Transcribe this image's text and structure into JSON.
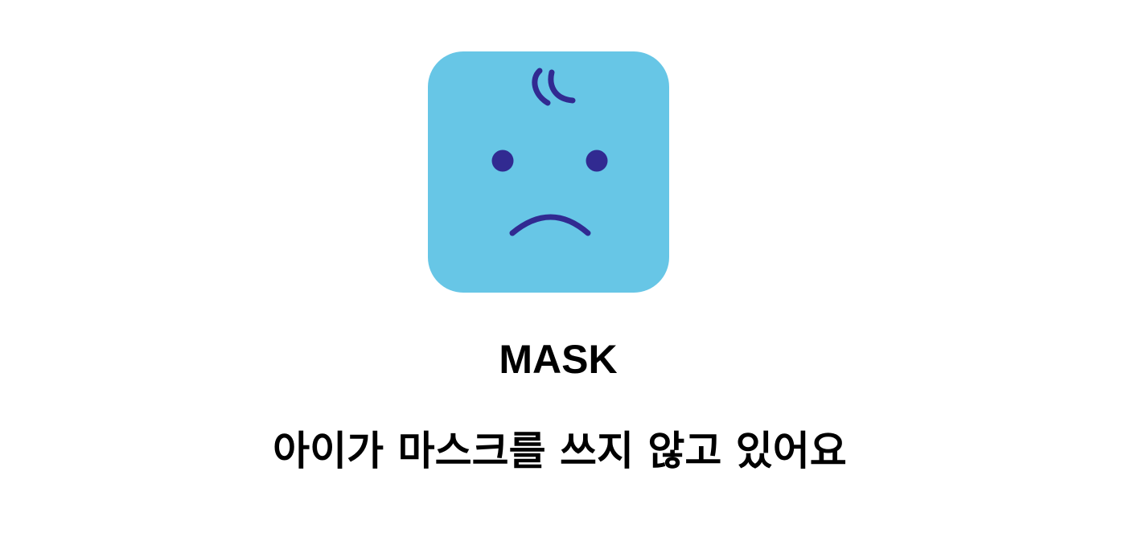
{
  "status_card": {
    "icon": "sad-face-icon",
    "colors": {
      "background": "#67c6e6",
      "features": "#312a91"
    },
    "title": "MASK",
    "message": "아이가 마스크를 쓰지 않고 있어요"
  }
}
